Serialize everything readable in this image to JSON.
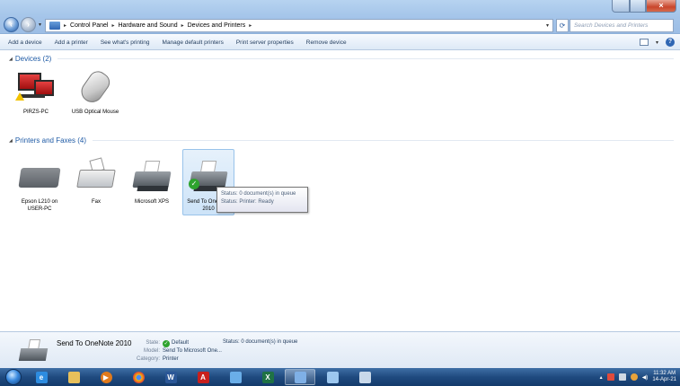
{
  "address": {
    "crumbs": [
      "Control Panel",
      "Hardware and Sound",
      "Devices and Printers"
    ],
    "search_placeholder": "Search Devices and Printers"
  },
  "toolbar": {
    "items": [
      "Add a device",
      "Add a printer",
      "See what's printing",
      "Manage default printers",
      "Print server properties",
      "Remove device"
    ]
  },
  "devices_group": {
    "title": "Devices (2)",
    "items": [
      {
        "label": "PIRZS-PC",
        "icon": "computer-icon",
        "warning": true
      },
      {
        "label": "USB Optical Mouse",
        "icon": "mouse-icon"
      }
    ]
  },
  "printers_group": {
    "title": "Printers and Faxes (4)",
    "items": [
      {
        "label": "Epson L210 on USER-PC",
        "icon": "printer-icon"
      },
      {
        "label": "Fax",
        "icon": "fax-icon"
      },
      {
        "label": "Microsoft XPS",
        "icon": "printer-icon"
      },
      {
        "label": "Send To OneNote 2010",
        "icon": "printer-icon",
        "selected": true,
        "default": true
      }
    ]
  },
  "tooltip": {
    "line1": "Status: 0 document(s) in queue",
    "line2": "Status: Printer:  Ready"
  },
  "details": {
    "name": "Send To OneNote 2010",
    "state_label": "State:",
    "state_value": "Default",
    "model_label": "Model:",
    "model_value": "Send To Microsoft One...",
    "category_label": "Category:",
    "category_value": "Printer",
    "status": "Status: 0 document(s) in queue"
  },
  "taskbar": {
    "apps": [
      "internet-explorer-icon",
      "file-explorer-icon",
      "media-player-icon",
      "chrome-icon",
      "word-icon",
      "acrobat-icon",
      "word-pad-icon",
      "excel-icon",
      "control-panel-icon",
      "snipping-icon",
      "paint-icon"
    ],
    "time": "11:32 AM",
    "date": "14-Apr-21"
  },
  "colors": {
    "accent": "#1e5aa5",
    "taskbar": "#1f4a7f",
    "default_check": "#2ea32e"
  }
}
